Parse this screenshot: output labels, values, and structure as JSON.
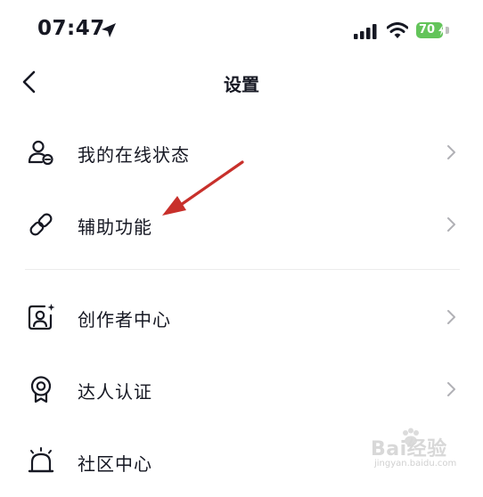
{
  "status_bar": {
    "time": "07:47",
    "battery": "70"
  },
  "nav": {
    "title": "设置"
  },
  "menu": [
    {
      "label": "我的在线状态",
      "icon": "user-status-icon"
    },
    {
      "label": "辅助功能",
      "icon": "link-icon"
    },
    {
      "label": "创作者中心",
      "icon": "creator-portrait-icon"
    },
    {
      "label": "达人认证",
      "icon": "badge-medal-icon"
    },
    {
      "label": "社区中心",
      "icon": "alarm-bell-icon"
    }
  ],
  "annotation": {
    "color": "#c8302b"
  },
  "colors": {
    "text": "#161823",
    "chevron": "#b0b0b5",
    "battery": "#63c45a"
  },
  "watermark": {
    "brand": "Bai经验",
    "sub": "jingyan.baidu.com"
  }
}
